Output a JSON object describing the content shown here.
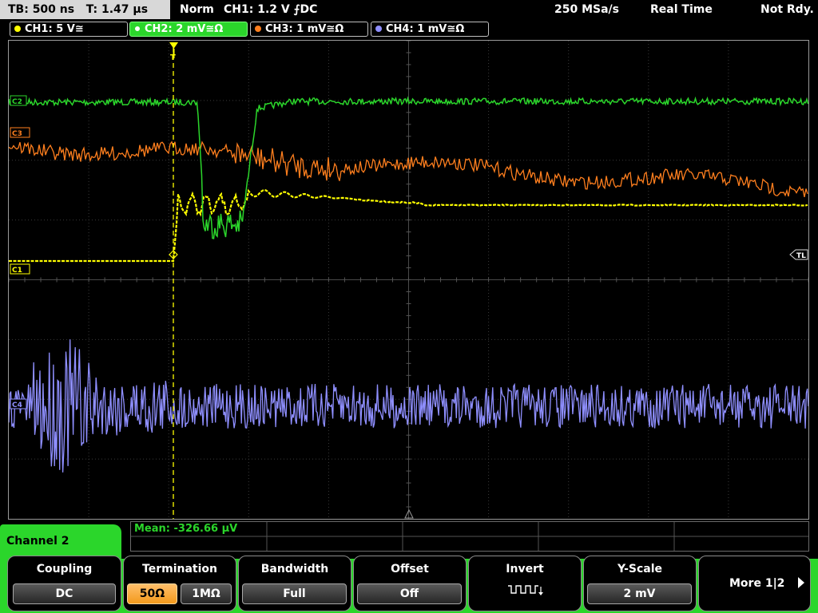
{
  "status_bar": {
    "timebase": "TB: 500 ns",
    "trigger_time": "T: 1.47 µs",
    "trigger_mode": "Norm",
    "trigger_info": "CH1: 1.2 V ⨍DC",
    "sample_rate": "250 MSa/s",
    "acq_mode": "Real Time",
    "status": "Not Rdy."
  },
  "channels": [
    {
      "label": "CH1: 5 V≅",
      "color": "#ffff00"
    },
    {
      "label": "CH2: 2 mV≅Ω",
      "color": "#2bd62b"
    },
    {
      "label": "CH3: 1 mV≅Ω",
      "color": "#ff7f1e"
    },
    {
      "label": "CH4: 1 mV≅Ω",
      "color": "#8f8fff"
    }
  ],
  "plot_markers": {
    "c2": "C2",
    "c3": "C3",
    "c1": "C1",
    "c4": "C4",
    "tl": "TL",
    "trigger": "T"
  },
  "measurement": {
    "mean": "Mean: -326.66 µV"
  },
  "menu": {
    "title": "Channel 2",
    "coupling": {
      "title": "Coupling",
      "value": "DC"
    },
    "termination": {
      "title": "Termination",
      "opt1": "50Ω",
      "opt2": "1MΩ",
      "selected": "50Ω"
    },
    "bandwidth": {
      "title": "Bandwidth",
      "value": "Full"
    },
    "offset": {
      "title": "Offset",
      "value": "Off"
    },
    "invert": {
      "title": "Invert"
    },
    "yscale": {
      "title": "Y-Scale",
      "value": "2 mV"
    },
    "more": {
      "label": "More 1|2"
    }
  }
}
